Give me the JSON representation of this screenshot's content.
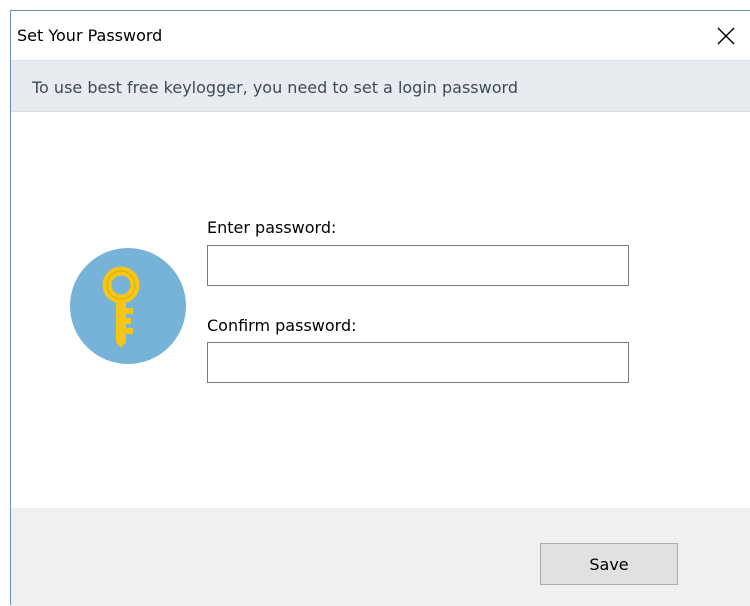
{
  "window": {
    "title": "Set Your Password"
  },
  "banner": {
    "text": "To use best free keylogger, you need to set a login password"
  },
  "form": {
    "enter_label": "Enter password:",
    "enter_value": "",
    "confirm_label": "Confirm password:",
    "confirm_value": ""
  },
  "footer": {
    "save_label": "Save"
  },
  "icons": {
    "close": "close-icon",
    "key": "key-icon"
  },
  "colors": {
    "key_circle": "#77b3d9",
    "key_gold": "#f5c518",
    "banner_bg": "#e8ecf0",
    "footer_bg": "#f0f0f0"
  }
}
